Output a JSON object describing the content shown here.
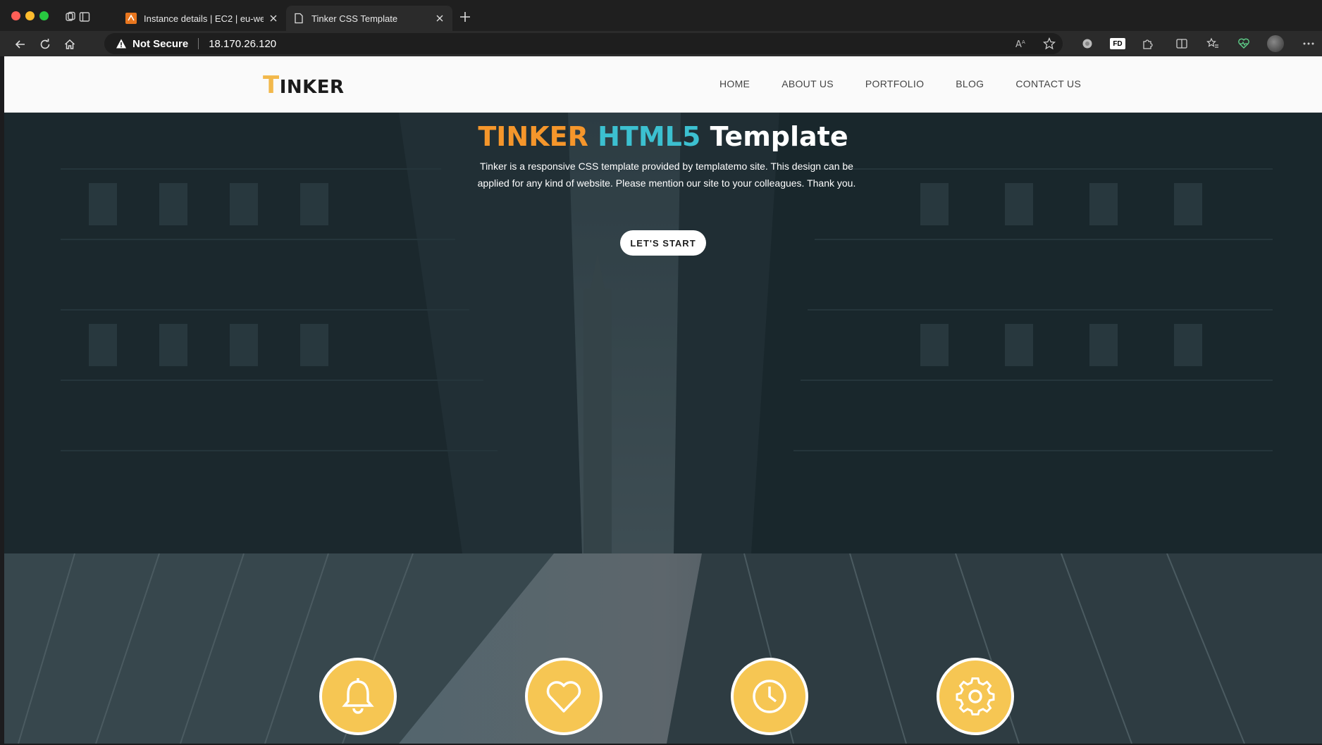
{
  "browser": {
    "tabs": [
      {
        "title": "Instance details | EC2 | eu-wes",
        "active": false
      },
      {
        "title": "Tinker CSS Template",
        "active": true
      }
    ],
    "address": {
      "security_label": "Not Secure",
      "url": "18.170.26.120"
    },
    "profile_badge": "FD"
  },
  "site": {
    "logo_first": "T",
    "logo_rest": "INKER",
    "nav": [
      "HOME",
      "ABOUT US",
      "PORTFOLIO",
      "BLOG",
      "CONTACT US"
    ],
    "hero": {
      "title_part1": "TINKER",
      "title_part2": "HTML5",
      "title_part3": "Template",
      "description": "Tinker is a responsive CSS template provided by templatemo site. This design can be applied for any kind of website. Please mention our site to your colleagues. Thank you.",
      "cta_label": "LET'S START"
    },
    "services": [
      "bell-icon",
      "heart-icon",
      "clock-icon",
      "gear-icon"
    ]
  },
  "colors": {
    "accent_yellow": "#f6c653",
    "title_orange": "#f5962b",
    "title_teal": "#3cc0d0"
  }
}
